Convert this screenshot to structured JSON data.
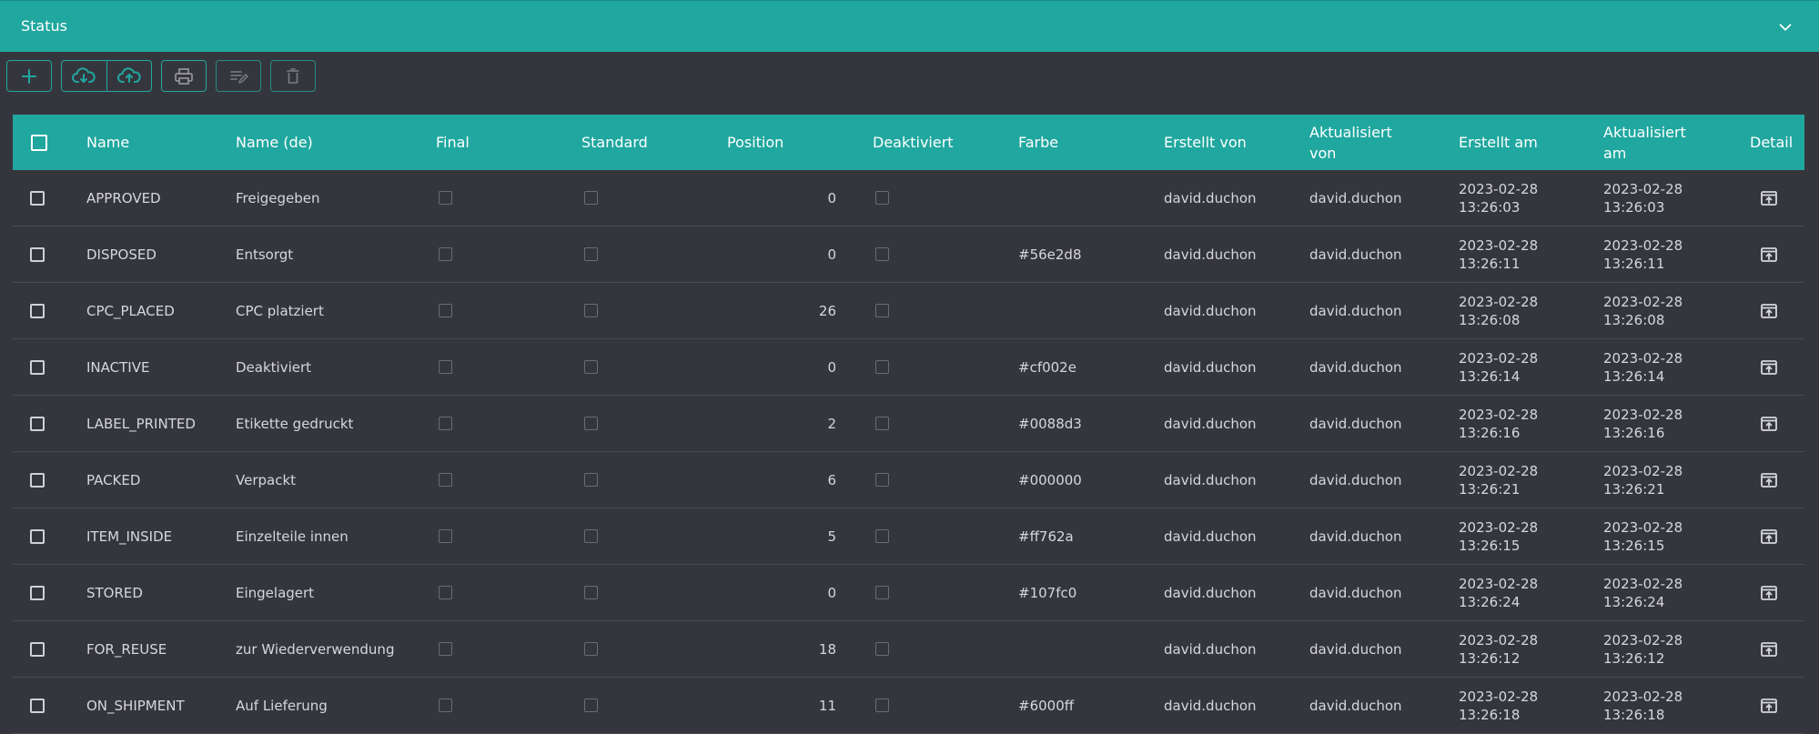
{
  "panel": {
    "title": "Status"
  },
  "columns": {
    "name": "Name",
    "name_de": "Name (de)",
    "final": "Final",
    "standard": "Standard",
    "position": "Position",
    "deactivated": "Deaktiviert",
    "color": "Farbe",
    "created_by": "Erstellt von",
    "updated_by_1": "Aktualisiert",
    "updated_by_2": "von",
    "created_at": "Erstellt am",
    "updated_at_1": "Aktualisiert",
    "updated_at_2": "am",
    "detail": "Detail"
  },
  "colors": {
    "accent": "#20a79f",
    "background": "#35363d"
  },
  "rows": [
    {
      "name": "APPROVED",
      "name_de": "Freigegeben",
      "position": "0",
      "color": "",
      "created_by": "david.duchon",
      "updated_by": "david.duchon",
      "created_date": "2023-02-28",
      "created_time": "13:26:03",
      "updated_date": "2023-02-28",
      "updated_time": "13:26:03"
    },
    {
      "name": "DISPOSED",
      "name_de": "Entsorgt",
      "position": "0",
      "color": "#56e2d8",
      "created_by": "david.duchon",
      "updated_by": "david.duchon",
      "created_date": "2023-02-28",
      "created_time": "13:26:11",
      "updated_date": "2023-02-28",
      "updated_time": "13:26:11"
    },
    {
      "name": "CPC_PLACED",
      "name_de": "CPC platziert",
      "position": "26",
      "color": "",
      "created_by": "david.duchon",
      "updated_by": "david.duchon",
      "created_date": "2023-02-28",
      "created_time": "13:26:08",
      "updated_date": "2023-02-28",
      "updated_time": "13:26:08"
    },
    {
      "name": "INACTIVE",
      "name_de": "Deaktiviert",
      "position": "0",
      "color": "#cf002e",
      "created_by": "david.duchon",
      "updated_by": "david.duchon",
      "created_date": "2023-02-28",
      "created_time": "13:26:14",
      "updated_date": "2023-02-28",
      "updated_time": "13:26:14"
    },
    {
      "name": "LABEL_PRINTED",
      "name_de": "Etikette gedruckt",
      "position": "2",
      "color": "#0088d3",
      "created_by": "david.duchon",
      "updated_by": "david.duchon",
      "created_date": "2023-02-28",
      "created_time": "13:26:16",
      "updated_date": "2023-02-28",
      "updated_time": "13:26:16"
    },
    {
      "name": "PACKED",
      "name_de": "Verpackt",
      "position": "6",
      "color": "#000000",
      "created_by": "david.duchon",
      "updated_by": "david.duchon",
      "created_date": "2023-02-28",
      "created_time": "13:26:21",
      "updated_date": "2023-02-28",
      "updated_time": "13:26:21"
    },
    {
      "name": "ITEM_INSIDE",
      "name_de": "Einzelteile innen",
      "position": "5",
      "color": "#ff762a",
      "created_by": "david.duchon",
      "updated_by": "david.duchon",
      "created_date": "2023-02-28",
      "created_time": "13:26:15",
      "updated_date": "2023-02-28",
      "updated_time": "13:26:15"
    },
    {
      "name": "STORED",
      "name_de": "Eingelagert",
      "position": "0",
      "color": "#107fc0",
      "created_by": "david.duchon",
      "updated_by": "david.duchon",
      "created_date": "2023-02-28",
      "created_time": "13:26:24",
      "updated_date": "2023-02-28",
      "updated_time": "13:26:24"
    },
    {
      "name": "FOR_REUSE",
      "name_de": "zur Wiederverwendung",
      "position": "18",
      "color": "",
      "created_by": "david.duchon",
      "updated_by": "david.duchon",
      "created_date": "2023-02-28",
      "created_time": "13:26:12",
      "updated_date": "2023-02-28",
      "updated_time": "13:26:12"
    },
    {
      "name": "ON_SHIPMENT",
      "name_de": "Auf Lieferung",
      "position": "11",
      "color": "#6000ff",
      "created_by": "david.duchon",
      "updated_by": "david.duchon",
      "created_date": "2023-02-28",
      "created_time": "13:26:18",
      "updated_date": "2023-02-28",
      "updated_time": "13:26:18"
    }
  ]
}
